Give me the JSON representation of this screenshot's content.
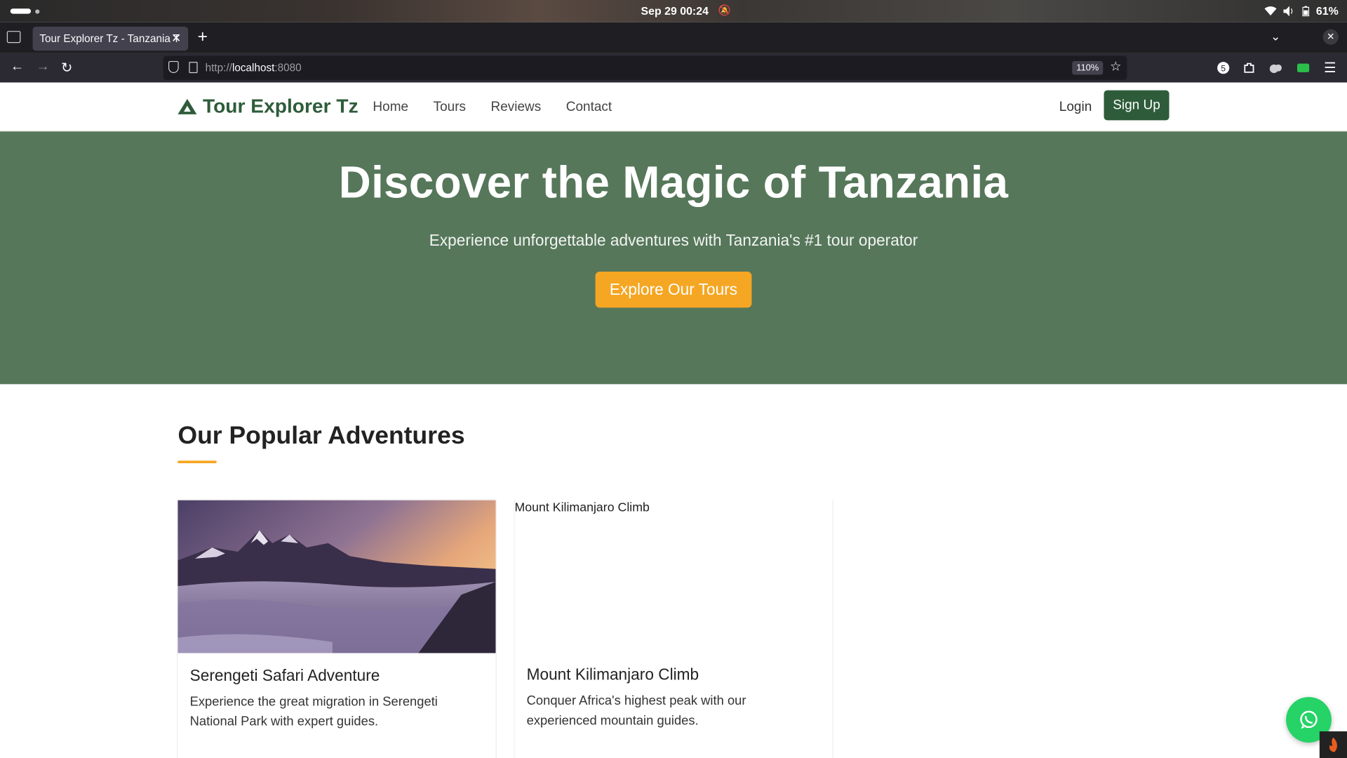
{
  "os": {
    "clock": "Sep 29  00:24",
    "battery": "61%"
  },
  "browser": {
    "tab_title": "Tour Explorer Tz - Tanzania T",
    "url_prefix": "http://",
    "url_host": "localhost",
    "url_port": ":8080",
    "zoom": "110%",
    "ext_badge": "5"
  },
  "site": {
    "brand": "Tour Explorer Tz",
    "menu": [
      "Home",
      "Tours",
      "Reviews",
      "Contact"
    ],
    "login": "Login",
    "signup": "Sign Up"
  },
  "hero": {
    "title": "Discover the Magic of Tanzania",
    "subtitle": "Experience unforgettable adventures with Tanzania's #1 tour operator",
    "cta": "Explore Our Tours"
  },
  "section": {
    "title": "Our Popular Adventures"
  },
  "tours": [
    {
      "title": "Serengeti Safari Adventure",
      "description": "Experience the great migration in Serengeti National Park with expert guides.",
      "image_alt": ""
    },
    {
      "title": "Mount Kilimanjaro Climb",
      "description": "Conquer Africa's highest peak with our experienced mountain guides.",
      "image_alt": "Mount Kilimanjaro Climb"
    }
  ],
  "colors": {
    "brand_green": "#2e5c3a",
    "hero_bg": "#56775a",
    "accent_orange": "#f5a623",
    "whatsapp_green": "#25d366"
  }
}
